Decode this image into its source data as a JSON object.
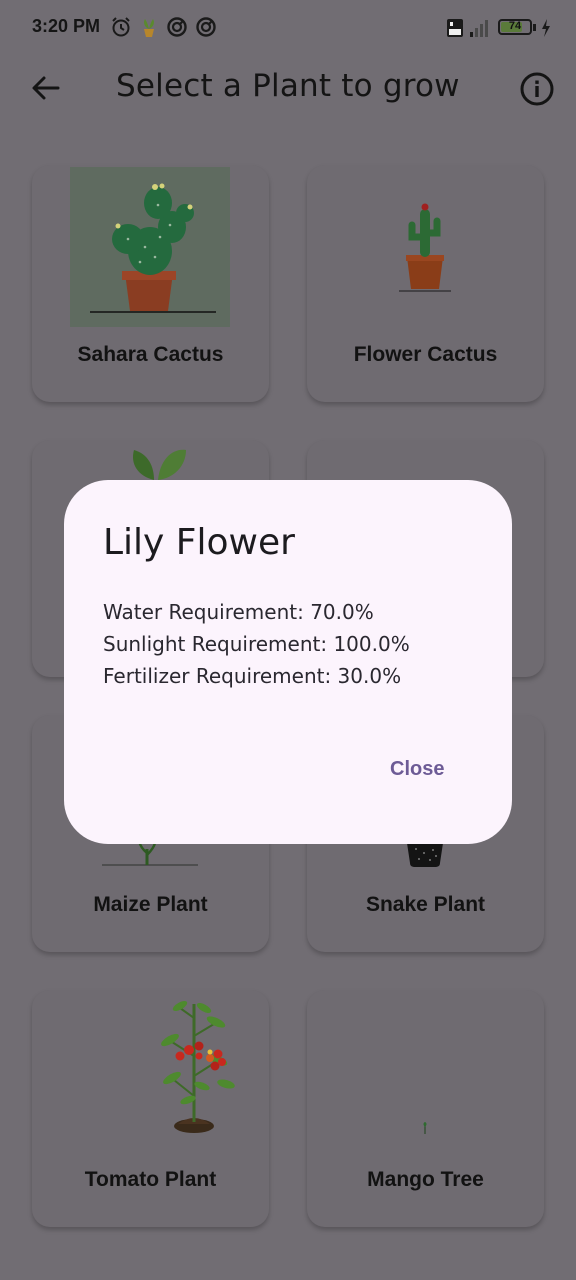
{
  "status_bar": {
    "time": "3:20 PM",
    "battery_level": "74",
    "battery_fraction": 0.74,
    "icons": [
      "alarm-icon",
      "plant-app-icon",
      "sync-icon",
      "sync-icon",
      "volte-icon",
      "signal-icon",
      "battery-icon",
      "charging-bolt-icon"
    ]
  },
  "app_bar": {
    "title": "Select a Plant to grow",
    "back_icon": "arrow-left-icon",
    "info_icon": "info-icon"
  },
  "plants": [
    {
      "name": "Sahara Cactus"
    },
    {
      "name": "Flower Cactus"
    },
    {
      "name": ""
    },
    {
      "name": ""
    },
    {
      "name": "Maize Plant"
    },
    {
      "name": "Snake Plant"
    },
    {
      "name": "Tomato Plant"
    },
    {
      "name": "Mango Tree"
    }
  ],
  "dialog": {
    "title": "Lily Flower",
    "lines": [
      "Water Requirement: 70.0%",
      "Sunlight Requirement: 100.0%",
      "Fertilizer Requirement: 30.0%"
    ],
    "close_label": "Close"
  },
  "colors": {
    "scrim_background": "#716d73",
    "dialog_background": "#fcf4fd",
    "accent": "#6d5b96"
  }
}
